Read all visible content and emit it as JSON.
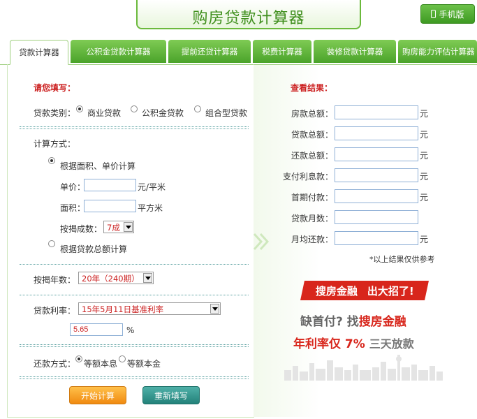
{
  "header": {
    "title": "购房贷款计算器",
    "mobile_label": "手机版"
  },
  "tabs": [
    {
      "label": "贷款计算器",
      "active": true
    },
    {
      "label": "公积金贷款计算器",
      "active": false
    },
    {
      "label": "提前还贷计算器",
      "active": false
    },
    {
      "label": "税费计算器",
      "active": false
    },
    {
      "label": "装修贷款计算器",
      "active": false
    },
    {
      "label": "购房能力评估计算器",
      "active": false
    }
  ],
  "form": {
    "heading": "请您填写：",
    "loan_type_label": "贷款类别：",
    "loan_types": [
      {
        "label": "商业贷款",
        "checked": true
      },
      {
        "label": "公积金贷款",
        "checked": false
      },
      {
        "label": "组合型贷款",
        "checked": false
      }
    ],
    "calc_method_label": "计算方式：",
    "method_area": {
      "label": "根据面积、单价计算",
      "checked": true
    },
    "unit_price_label": "单价：",
    "unit_price_value": "",
    "unit_price_unit": "元/平米",
    "area_label": "面积：",
    "area_value": "",
    "area_unit": "平方米",
    "mortgage_ratio_label": "按揭成数：",
    "mortgage_ratio_value": "7成",
    "method_total": {
      "label": "根据贷款总额计算",
      "checked": false
    },
    "years_label": "按揭年数：",
    "years_value": "20年（240期）",
    "rate_label": "贷款利率：",
    "rate_value": "15年5月11日基准利率",
    "rate_percent": "5.65",
    "rate_unit": "%",
    "repay_label": "还款方式：",
    "repay_options": [
      {
        "label": "等额本息",
        "checked": true
      },
      {
        "label": "等额本金",
        "checked": false
      }
    ],
    "calc_button": "开始计算",
    "reset_button": "重新填写"
  },
  "results": {
    "heading": "查看结果：",
    "rows": [
      {
        "label": "房款总额：",
        "unit": "元"
      },
      {
        "label": "贷款总额：",
        "unit": "元"
      },
      {
        "label": "还款总额：",
        "unit": "元"
      },
      {
        "label": "支付利息款：",
        "unit": "元"
      },
      {
        "label": "首期付款：",
        "unit": "元"
      },
      {
        "label": "贷款月数：",
        "unit": ""
      },
      {
        "label": "月均还款：",
        "unit": "元"
      }
    ],
    "note": "*以上结果仅供参考"
  },
  "promo": {
    "banner_left": "搜房金融",
    "banner_right": "出大招了!",
    "line2_a": "缺首付?",
    "line2_b": "找",
    "line2_c": "搜房金融",
    "line3_a": "年利率仅 7%",
    "line3_b": "三天放款"
  },
  "colors": {
    "brand_green": "#4aa32a",
    "accent_red": "#cc2222",
    "orange_button": "#f08a10",
    "teal_button": "#23827a"
  }
}
